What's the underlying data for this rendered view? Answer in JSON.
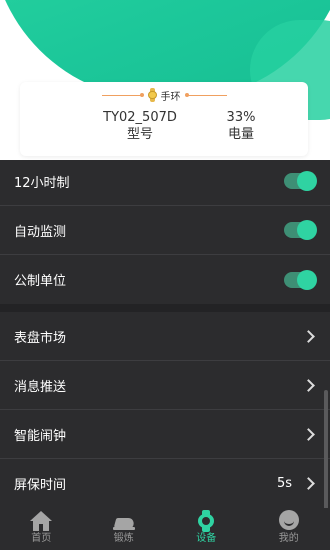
{
  "device_card": {
    "title": "手环",
    "model_value": "TY02_507D",
    "model_label": "型号",
    "battery_value": "33%",
    "battery_label": "电量"
  },
  "settings": {
    "toggles": [
      {
        "label": "12小时制",
        "on": true
      },
      {
        "label": "自动监测",
        "on": true
      },
      {
        "label": "公制单位",
        "on": true
      }
    ],
    "links": [
      {
        "label": "表盘市场"
      },
      {
        "label": "消息推送"
      },
      {
        "label": "智能闹钟"
      },
      {
        "label": "屏保时间",
        "value": "5s"
      }
    ]
  },
  "tabbar": {
    "tabs": [
      {
        "label": "首页",
        "icon": "home-icon",
        "active": false
      },
      {
        "label": "锻炼",
        "icon": "shoe-icon",
        "active": false
      },
      {
        "label": "设备",
        "icon": "watch-icon",
        "active": true
      },
      {
        "label": "我的",
        "icon": "profile-icon",
        "active": false
      }
    ]
  },
  "colors": {
    "accent": "#2fd3a2",
    "background": "#2c2c2e",
    "hero": "#1cc79a"
  }
}
